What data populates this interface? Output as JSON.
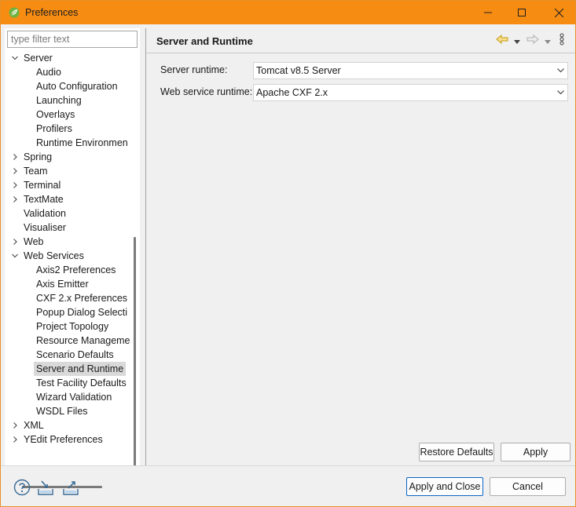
{
  "window": {
    "title": "Preferences",
    "icon": "spring-leaf-icon",
    "accent_color": "#f68c12"
  },
  "filter": {
    "placeholder": "type filter text",
    "value": ""
  },
  "tree": {
    "items": [
      {
        "label": "Server",
        "level": 0,
        "expander": "expanded"
      },
      {
        "label": "Audio",
        "level": 1,
        "expander": "none"
      },
      {
        "label": "Auto Configuration",
        "level": 1,
        "expander": "none"
      },
      {
        "label": "Launching",
        "level": 1,
        "expander": "none"
      },
      {
        "label": "Overlays",
        "level": 1,
        "expander": "none"
      },
      {
        "label": "Profilers",
        "level": 1,
        "expander": "none"
      },
      {
        "label": "Runtime Environmen",
        "level": 1,
        "expander": "none"
      },
      {
        "label": "Spring",
        "level": 0,
        "expander": "collapsed"
      },
      {
        "label": "Team",
        "level": 0,
        "expander": "collapsed"
      },
      {
        "label": "Terminal",
        "level": 0,
        "expander": "collapsed"
      },
      {
        "label": "TextMate",
        "level": 0,
        "expander": "collapsed"
      },
      {
        "label": "Validation",
        "level": 0,
        "expander": "none"
      },
      {
        "label": "Visualiser",
        "level": 0,
        "expander": "none"
      },
      {
        "label": "Web",
        "level": 0,
        "expander": "collapsed"
      },
      {
        "label": "Web Services",
        "level": 0,
        "expander": "expanded"
      },
      {
        "label": "Axis2 Preferences",
        "level": 1,
        "expander": "none"
      },
      {
        "label": "Axis Emitter",
        "level": 1,
        "expander": "none"
      },
      {
        "label": "CXF 2.x Preferences",
        "level": 1,
        "expander": "none"
      },
      {
        "label": "Popup Dialog Selecti",
        "level": 1,
        "expander": "none"
      },
      {
        "label": "Project Topology",
        "level": 1,
        "expander": "none"
      },
      {
        "label": "Resource Manageme",
        "level": 1,
        "expander": "none"
      },
      {
        "label": "Scenario Defaults",
        "level": 1,
        "expander": "none"
      },
      {
        "label": "Server and Runtime",
        "level": 1,
        "expander": "none",
        "selected": true
      },
      {
        "label": "Test Facility Defaults",
        "level": 1,
        "expander": "none"
      },
      {
        "label": "Wizard Validation",
        "level": 1,
        "expander": "none"
      },
      {
        "label": "WSDL Files",
        "level": 1,
        "expander": "none"
      },
      {
        "label": "XML",
        "level": 0,
        "expander": "collapsed"
      },
      {
        "label": "YEdit Preferences",
        "level": 0,
        "expander": "collapsed"
      }
    ]
  },
  "page": {
    "title": "Server and Runtime",
    "nav_icons": [
      "back-arrow-icon",
      "back-menu-chevron-icon",
      "forward-arrow-icon",
      "forward-menu-chevron-icon",
      "view-menu-icon"
    ],
    "fields": [
      {
        "label": "Server runtime:",
        "value": "Tomcat v8.5 Server"
      },
      {
        "label": "Web service runtime:",
        "value": "Apache CXF 2.x"
      }
    ],
    "restore_defaults_label": "Restore Defaults",
    "apply_label": "Apply"
  },
  "footer": {
    "icons": [
      "help-icon",
      "import-icon",
      "export-icon"
    ],
    "apply_close_label": "Apply and Close",
    "cancel_label": "Cancel"
  }
}
